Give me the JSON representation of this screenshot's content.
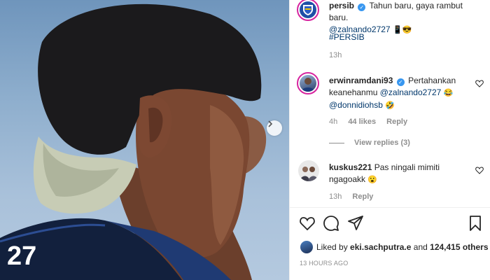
{
  "post": {
    "author": "persib",
    "caption_text": "Tahun baru, gaya rambut baru.",
    "caption_mention": "@zalnando2727",
    "caption_emoji": "📱😎",
    "hashtag": "#PERSIB",
    "time": "13h"
  },
  "comments": [
    {
      "user": "erwinramdani93",
      "text_start": "Pertahankan keanehanmu",
      "mention1": "@zalnando2727",
      "emoji1": "😂",
      "mention2": "@donnidiohsb",
      "emoji2": "🤣",
      "time": "4h",
      "likes": "44 likes",
      "reply_label": "Reply",
      "view_replies": "View replies (3)"
    },
    {
      "user": "kuskus221",
      "text": "Pas ningali mimiti ngagoakk",
      "emoji": "😮",
      "time": "13h",
      "reply_label": "Reply"
    }
  ],
  "likes": {
    "prefix": "Liked by",
    "user": "eki.sachputra.e",
    "conjunction": "and",
    "count": "124,415 others"
  },
  "timestamp": "13 HOURS AGO",
  "jersey_number": "27",
  "colors": {
    "verified": "#3897f0",
    "mention": "#00376b",
    "meta": "#8e8e8e"
  },
  "icons": [
    "chevron-right-icon",
    "heart-icon",
    "comment-icon",
    "share-icon",
    "bookmark-icon",
    "verified-icon"
  ]
}
